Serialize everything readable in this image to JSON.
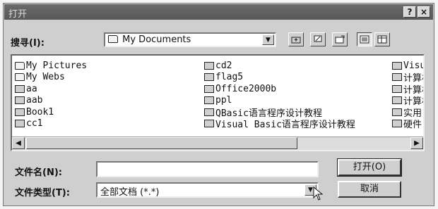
{
  "window": {
    "title": "打开",
    "help_glyph": "?",
    "close_glyph": "×"
  },
  "lookin": {
    "label": "搜寻(I):",
    "value": "My Documents",
    "dropdown_glyph": "▼"
  },
  "toolbar": {
    "icons": [
      "up-one-level-icon",
      "desktop-icon",
      "new-folder-icon",
      "list-view-icon",
      "details-view-icon"
    ]
  },
  "files": {
    "col1": [
      {
        "name": "My Pictures",
        "icon": "folder-icon"
      },
      {
        "name": "My Webs",
        "icon": "folder-icon"
      },
      {
        "name": "aa",
        "icon": "document-icon"
      },
      {
        "name": "aab",
        "icon": "document-icon"
      },
      {
        "name": "Book1",
        "icon": "document-icon"
      },
      {
        "name": "cc1",
        "icon": "document-icon"
      }
    ],
    "col2": [
      {
        "name": "cd2",
        "icon": "document-icon"
      },
      {
        "name": "flag5",
        "icon": "document-icon"
      },
      {
        "name": "Office2000b",
        "icon": "document-icon"
      },
      {
        "name": "ppl",
        "icon": "document-icon"
      },
      {
        "name": "QBasic语言程序设计教程",
        "icon": "document-icon"
      },
      {
        "name": "Visual Basic语言程序设计教程",
        "icon": "document-icon"
      }
    ],
    "col3": [
      {
        "name": "Visu",
        "icon": "document-icon"
      },
      {
        "name": "计算机",
        "icon": "document-icon"
      },
      {
        "name": "计算机",
        "icon": "document-icon"
      },
      {
        "name": "计算机",
        "icon": "document-icon"
      },
      {
        "name": "实用",
        "icon": "document-icon"
      },
      {
        "name": "硬件",
        "icon": "document-icon"
      }
    ]
  },
  "scroll": {
    "left_glyph": "◀",
    "right_glyph": "▶"
  },
  "filename": {
    "label": "文件名(N):",
    "value": ""
  },
  "filetype": {
    "label": "文件类型(T):",
    "value": "全部文档 (*.*)"
  },
  "buttons": {
    "open": "打开(O)",
    "cancel": "取消"
  }
}
